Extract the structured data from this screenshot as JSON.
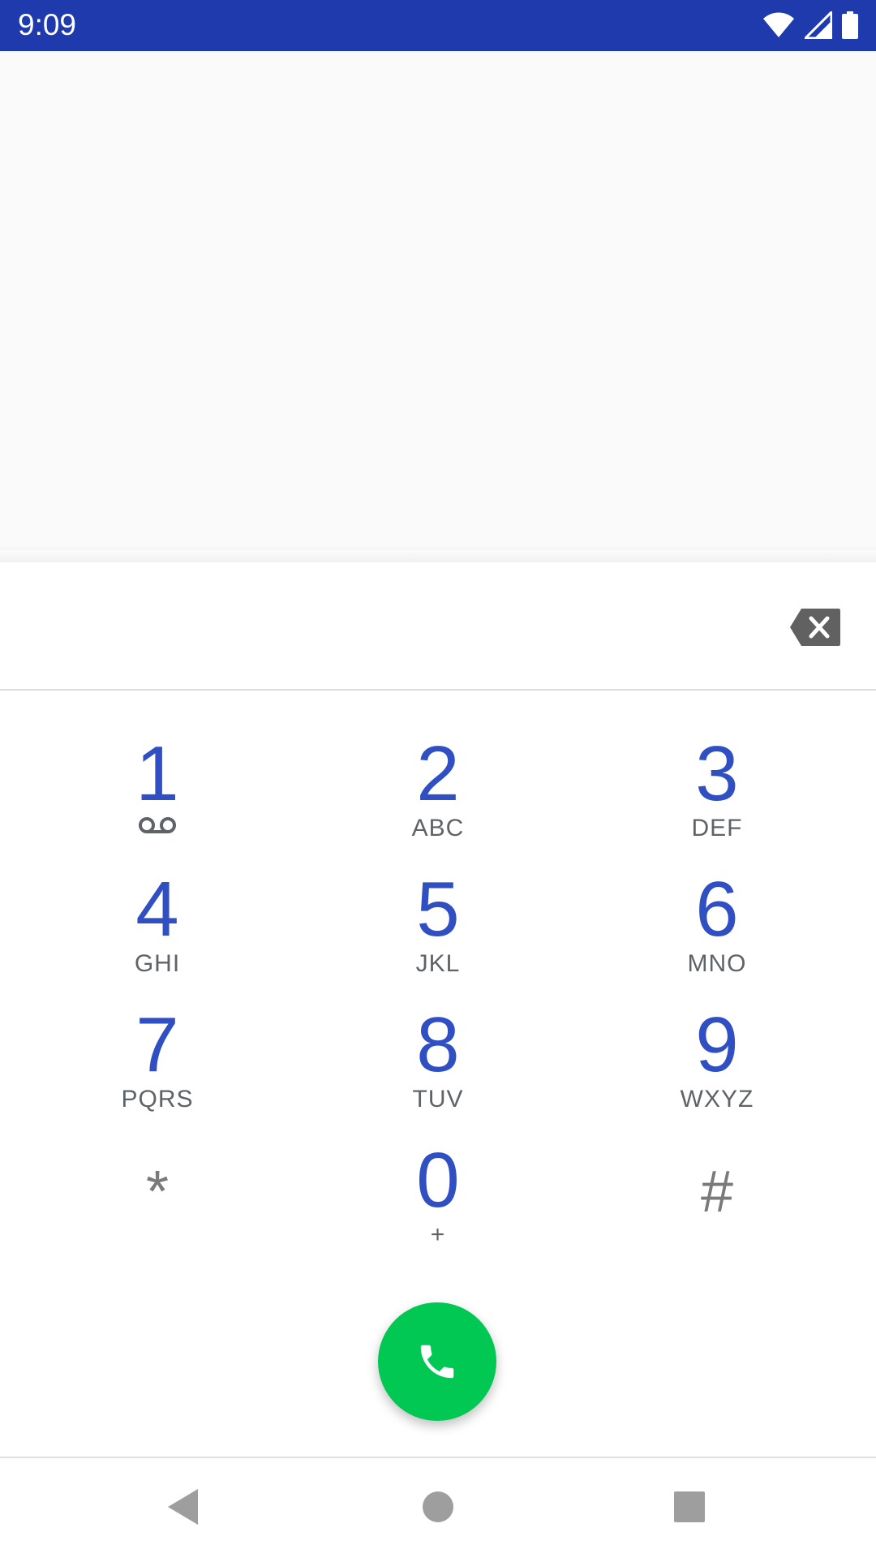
{
  "status_bar": {
    "time": "9:09",
    "background": "#1e3aad",
    "icons": [
      "wifi-icon",
      "signal-icon",
      "battery-icon"
    ]
  },
  "dialer": {
    "digits_value": "",
    "backspace_icon": "backspace-icon",
    "keys": [
      {
        "digit": "1",
        "letters": "",
        "sub_icon": "voicemail-icon"
      },
      {
        "digit": "2",
        "letters": "ABC"
      },
      {
        "digit": "3",
        "letters": "DEF"
      },
      {
        "digit": "4",
        "letters": "GHI"
      },
      {
        "digit": "5",
        "letters": "JKL"
      },
      {
        "digit": "6",
        "letters": "MNO"
      },
      {
        "digit": "7",
        "letters": "PQRS"
      },
      {
        "digit": "8",
        "letters": "TUV"
      },
      {
        "digit": "9",
        "letters": "WXYZ"
      },
      {
        "digit": "*",
        "letters": ""
      },
      {
        "digit": "0",
        "letters": "+"
      },
      {
        "digit": "#",
        "letters": ""
      }
    ],
    "call_button_icon": "phone-icon",
    "call_button_color": "#00c853",
    "digit_color": "#2f4fc3"
  },
  "nav_bar": {
    "buttons": [
      "back-icon",
      "home-icon",
      "recents-icon"
    ]
  }
}
